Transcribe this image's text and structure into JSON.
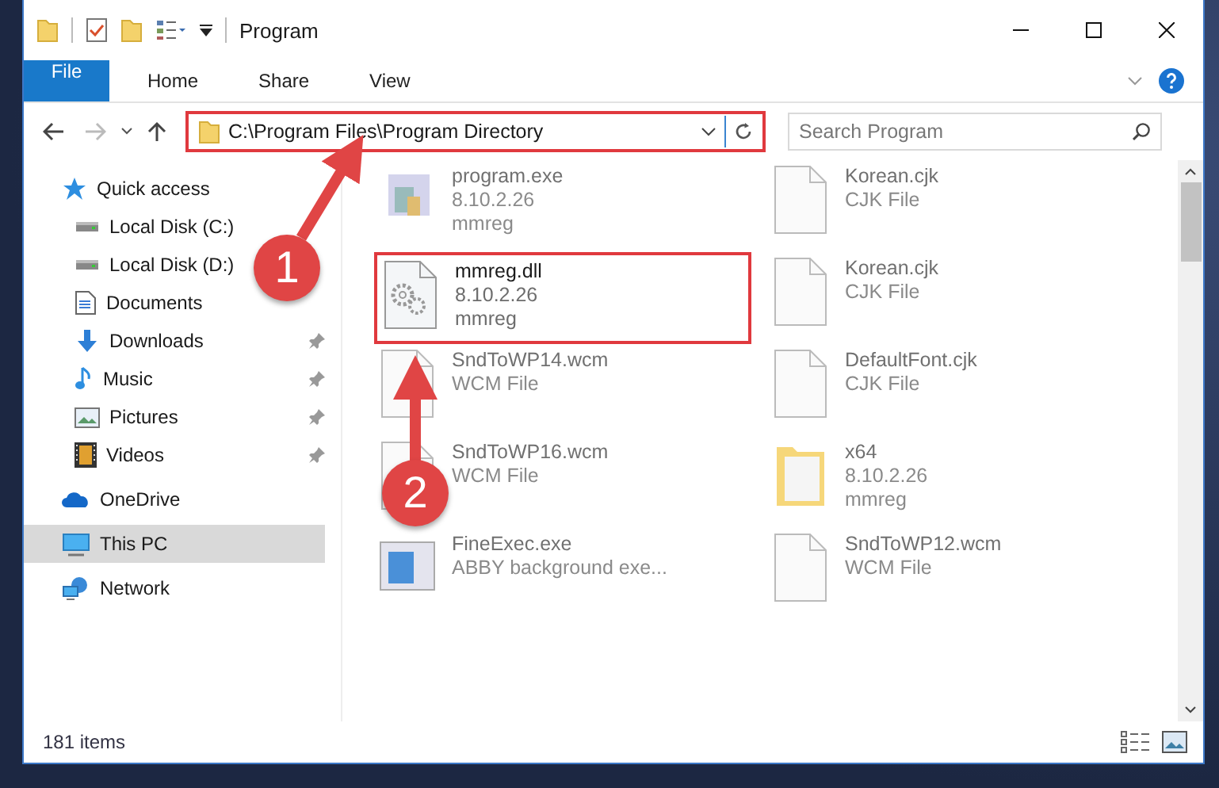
{
  "window": {
    "title": "Program"
  },
  "ribbon_tabs": [
    {
      "label": "File",
      "kind": "file"
    },
    {
      "label": "Home",
      "kind": "tab"
    },
    {
      "label": "Share",
      "kind": "tab"
    },
    {
      "label": "View",
      "kind": "tab"
    }
  ],
  "address_bar": {
    "path": "C:\\Program Files\\Program Directory",
    "highlighted": true
  },
  "search": {
    "placeholder": "Search Program"
  },
  "navigation": [
    {
      "label": "Quick access",
      "kind": "star",
      "selected": false,
      "children": [
        {
          "label": "Local Disk (C:)",
          "kind": "disk",
          "pinned": false,
          "selected": false
        },
        {
          "label": "Local Disk (D:)",
          "kind": "disk",
          "pinned": false,
          "selected": false
        },
        {
          "label": "Documents",
          "kind": "document",
          "pinned": false,
          "selected": false
        },
        {
          "label": "Downloads",
          "kind": "download",
          "pinned": true,
          "selected": false
        },
        {
          "label": "Music",
          "kind": "music",
          "pinned": true,
          "selected": false
        },
        {
          "label": "Pictures",
          "kind": "pictures",
          "pinned": true,
          "selected": false
        },
        {
          "label": "Videos",
          "kind": "videos",
          "pinned": true,
          "selected": false
        }
      ]
    },
    {
      "label": "OneDrive",
      "kind": "cloud",
      "selected": false
    },
    {
      "label": "This PC",
      "kind": "pc",
      "selected": true
    },
    {
      "label": "Network",
      "kind": "network",
      "selected": false
    }
  ],
  "files": [
    {
      "name": "program.exe",
      "details": [
        "8.10.2.26",
        "mmreg"
      ],
      "kind": "exe",
      "highlighted": false
    },
    {
      "name": "Korean.cjk",
      "details": [
        "CJK File"
      ],
      "kind": "file",
      "highlighted": false
    },
    {
      "name": "mmreg.dll",
      "details": [
        "8.10.2.26",
        "mmreg"
      ],
      "kind": "dll",
      "highlighted": true
    },
    {
      "name": "Korean.cjk",
      "details": [
        "CJK File"
      ],
      "kind": "file",
      "highlighted": false
    },
    {
      "name": "SndToWP14.wcm",
      "details": [
        "WCM File"
      ],
      "kind": "file",
      "highlighted": false
    },
    {
      "name": "DefaultFont.cjk",
      "details": [
        "CJK File"
      ],
      "kind": "file",
      "highlighted": false
    },
    {
      "name": "SndToWP16.wcm",
      "details": [
        "WCM File"
      ],
      "kind": "file",
      "highlighted": false
    },
    {
      "name": "x64",
      "details": [
        "8.10.2.26",
        "mmreg"
      ],
      "kind": "folder",
      "highlighted": false
    },
    {
      "name": "FineExec.exe",
      "details": [
        "ABBY background exe..."
      ],
      "kind": "app",
      "highlighted": false
    },
    {
      "name": "SndToWP12.wcm",
      "details": [
        "WCM File"
      ],
      "kind": "file",
      "highlighted": false
    }
  ],
  "steps": [
    {
      "number": "1"
    },
    {
      "number": "2"
    }
  ],
  "status_bar": {
    "item_count": "181 items"
  }
}
